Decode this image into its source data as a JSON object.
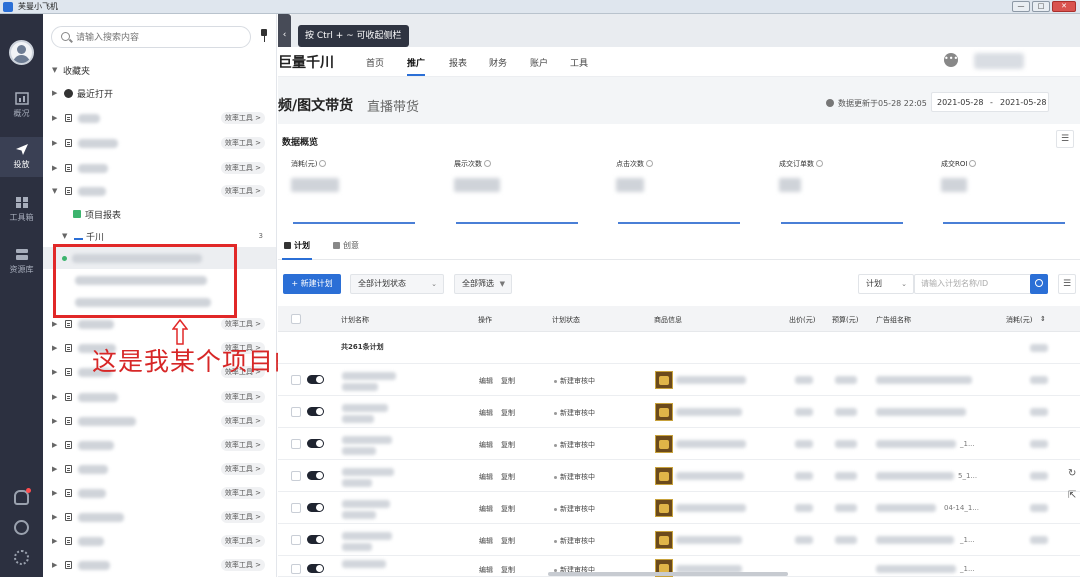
{
  "window": {
    "title": "芙曼小飞机",
    "buttons": [
      "—",
      "□",
      "✕"
    ]
  },
  "rail": {
    "items": [
      {
        "label": "概况",
        "icon": "chart-bar-icon"
      },
      {
        "label": "投放",
        "icon": "send-icon",
        "active": true
      },
      {
        "label": "工具箱",
        "icon": "grid-icon"
      },
      {
        "label": "资源库",
        "icon": "database-icon"
      }
    ],
    "bottom_icons": [
      "bell-icon",
      "help-icon",
      "settings-icon"
    ]
  },
  "sidebar": {
    "search_placeholder": "请输入搜索内容",
    "favorites_label": "收藏夹",
    "recent_label": "最近打开",
    "tool_tag": "效率工具 >",
    "project_report_label": "项目报表",
    "qianchuan_label": "千川",
    "qianchuan_count": "3"
  },
  "annotation": {
    "text": "这是我某个项目的三个千川账号"
  },
  "collapse": {
    "arrow": "‹",
    "tooltip": "按 Ctrl + ~ 可收起侧栏"
  },
  "header": {
    "brand": "巨量千川",
    "nav": [
      "首页",
      "推广",
      "报表",
      "财务",
      "账户",
      "工具"
    ],
    "active_nav": "推广"
  },
  "page": {
    "title": "频/图文带货",
    "subtitle": "直播带货",
    "update_text": "数据更新于05-28 22:05",
    "date_start": "2021-05-28",
    "date_sep": "-",
    "date_end": "2021-05-28"
  },
  "overview": {
    "title": "数据概览",
    "metrics": [
      "消耗(元)",
      "展示次数",
      "点击次数",
      "成交订单数",
      "成交ROI"
    ]
  },
  "tabs": {
    "items": [
      "计划",
      "创意"
    ],
    "active": "计划"
  },
  "toolbar": {
    "new_plan": "+ 新建计划",
    "plan_status": "全部计划状态",
    "filter": "全部筛选",
    "search_type": "计划",
    "search_placeholder": "请输入计划名称/ID"
  },
  "table": {
    "headers": [
      "计划名称",
      "操作",
      "计划状态",
      "商品信息",
      "出价(元)",
      "预算(元)",
      "广告组名称",
      "消耗(元)"
    ],
    "sort_icon": "⇕",
    "summary": "共261条计划",
    "edit": "编辑",
    "copy": "复制",
    "status": "新建审核中",
    "row_suffixes": [
      "",
      "",
      "_1...",
      "5_1...",
      "",
      "04-14_1...",
      "_1...",
      "_1..."
    ]
  }
}
